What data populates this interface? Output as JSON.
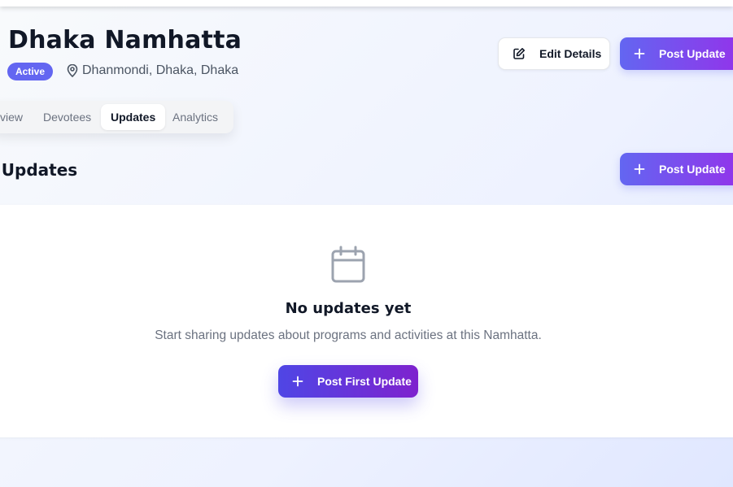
{
  "header": {
    "title": "Dhaka Namhatta",
    "status": "Active",
    "location": "Dhanmondi, Dhaka, Dhaka",
    "edit_label": "Edit Details",
    "post_label": "Post Update"
  },
  "tabs": [
    {
      "label": "view"
    },
    {
      "label": "Devotees"
    },
    {
      "label": "Updates",
      "active": true
    },
    {
      "label": "Analytics"
    }
  ],
  "section": {
    "title": "nt Updates",
    "post_label": "Post Update"
  },
  "empty_state": {
    "icon": "calendar-icon",
    "title": "No updates yet",
    "description": "Start sharing updates about programs and activities at this Namhatta.",
    "button_label": "Post First Update"
  },
  "colors": {
    "accent_start": "#6366f1",
    "accent_end": "#9333ea",
    "badge": "#6366f1"
  }
}
